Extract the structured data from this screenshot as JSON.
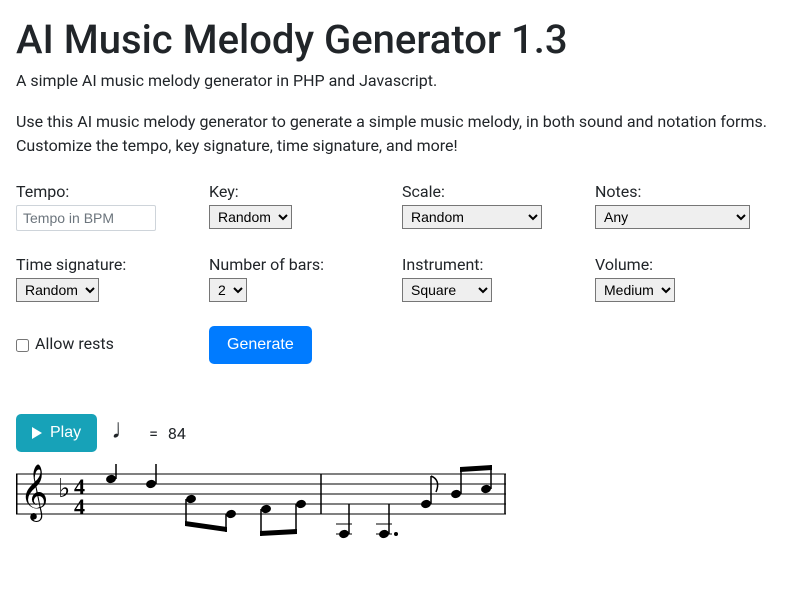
{
  "title": "AI Music Melody Generator 1.3",
  "subtitle": "A simple AI music melody generator in PHP and Javascript.",
  "description": "Use this AI music melody generator to generate a simple music melody, in both sound and notation forms. Customize the tempo, key signature, time signature, and more!",
  "fields": {
    "tempo": {
      "label": "Tempo:",
      "placeholder": "Tempo in BPM"
    },
    "key": {
      "label": "Key:",
      "selected": "Random"
    },
    "scale": {
      "label": "Scale:",
      "selected": "Random"
    },
    "notes": {
      "label": "Notes:",
      "selected": "Any"
    },
    "timeSignature": {
      "label": "Time signature:",
      "selected": "Random"
    },
    "bars": {
      "label": "Number of bars:",
      "selected": "2"
    },
    "instrument": {
      "label": "Instrument:",
      "selected": "Square"
    },
    "volume": {
      "label": "Volume:",
      "selected": "Medium"
    },
    "allowRests": {
      "label": "Allow rests"
    }
  },
  "buttons": {
    "generate": "Generate",
    "play": "Play"
  },
  "tempoDisplay": {
    "equals": "=",
    "bpm": "84"
  }
}
